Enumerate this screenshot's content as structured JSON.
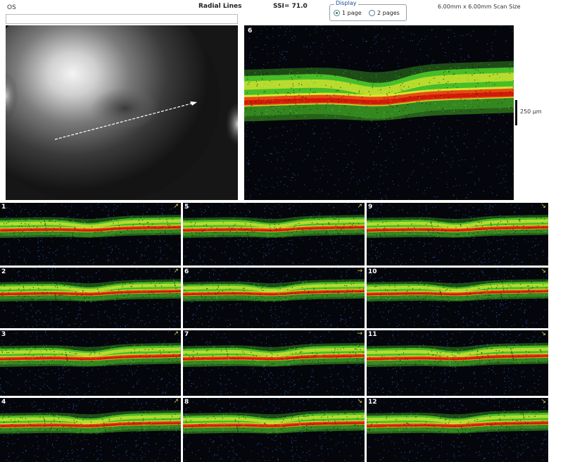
{
  "header": {
    "eye": "OS",
    "scan_title": "Radial Lines",
    "ssi": "SSI= 71.0",
    "display_label": "Display",
    "display_options": [
      "1 page",
      "2 pages"
    ],
    "display_selected": "1 page",
    "scan_size": "6.00mm x 6.00mm Scan Size"
  },
  "main_scan": {
    "number": "6",
    "scale_label": "250 µm"
  },
  "thumbnails": [
    {
      "number": "1",
      "arrow": "↗"
    },
    {
      "number": "2",
      "arrow": "↗"
    },
    {
      "number": "3",
      "arrow": "↗"
    },
    {
      "number": "4",
      "arrow": "↗"
    },
    {
      "number": "5",
      "arrow": "↗"
    },
    {
      "number": "6",
      "arrow": "→"
    },
    {
      "number": "7",
      "arrow": "→"
    },
    {
      "number": "8",
      "arrow": "↘"
    },
    {
      "number": "9",
      "arrow": "↘"
    },
    {
      "number": "10",
      "arrow": "↘"
    },
    {
      "number": "11",
      "arrow": "↘"
    },
    {
      "number": "12",
      "arrow": "↘"
    }
  ],
  "colors": {
    "retina_green": "#4fd12a",
    "retina_yellow": "#e8e832",
    "rpe_orange": "#e84a10",
    "rpe_red": "#d01a0a",
    "noise_blue": "#3060c0",
    "background": "#04060c"
  }
}
